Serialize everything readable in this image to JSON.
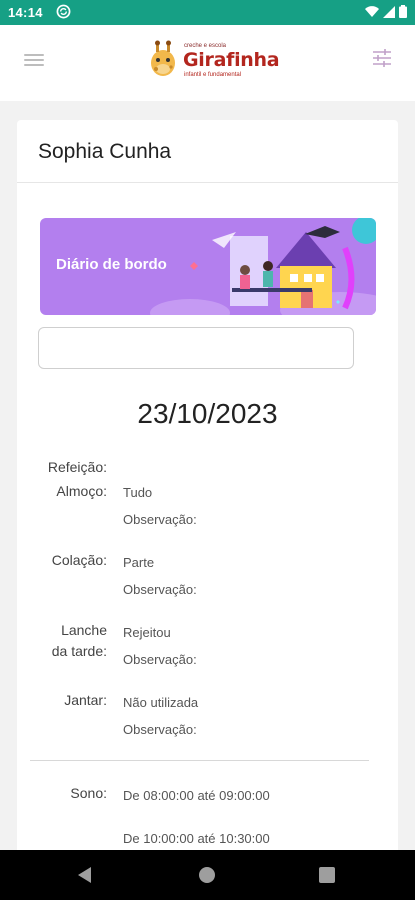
{
  "status_bar": {
    "time": "14:14"
  },
  "header": {
    "logo_small": "creche e escola",
    "logo_name": "Girafinha",
    "logo_sub": "infantil e fundamental"
  },
  "student": {
    "name": "Sophia Cunha"
  },
  "banner": {
    "title": "Diário de bordo"
  },
  "search": {
    "value": "",
    "placeholder": ""
  },
  "date": "23/10/2023",
  "meals": {
    "heading": "Refeição:",
    "items": [
      {
        "label_1": "Almoço:",
        "label_2": "",
        "value": "Tudo",
        "obs_label": "Observação:"
      },
      {
        "label_1": "Colação:",
        "label_2": "",
        "value": "Parte",
        "obs_label": "Observação:"
      },
      {
        "label_1": "Lanche",
        "label_2": "da tarde:",
        "value": "Rejeitou",
        "obs_label": "Observação:"
      },
      {
        "label_1": "Jantar:",
        "label_2": "",
        "value": "Não utilizada",
        "obs_label": "Observação:"
      }
    ]
  },
  "sleep": {
    "label": "Sono:",
    "periods": [
      "De 08:00:00 até 09:00:00",
      "De 10:00:00 até 10:30:00"
    ]
  },
  "colors": {
    "status_bar": "#16a085",
    "banner": "#b37fee",
    "logo_red": "#b3261e"
  }
}
